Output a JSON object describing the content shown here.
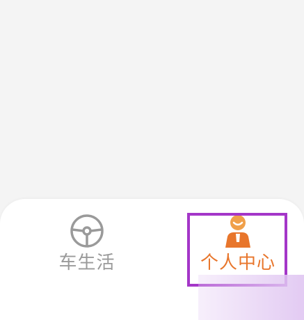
{
  "tabbar": {
    "tabs": [
      {
        "label": "车生活",
        "icon": "steering-wheel-icon",
        "color": "#9a9a9a",
        "active": false
      },
      {
        "label": "个人中心",
        "icon": "person-icon",
        "color": "#e8762c",
        "active": true
      }
    ]
  },
  "colors": {
    "background": "#f4f4f4",
    "tabbar": "#ffffff",
    "inactive": "#9a9a9a",
    "active": "#e8762c",
    "highlight": "#a436c8"
  }
}
